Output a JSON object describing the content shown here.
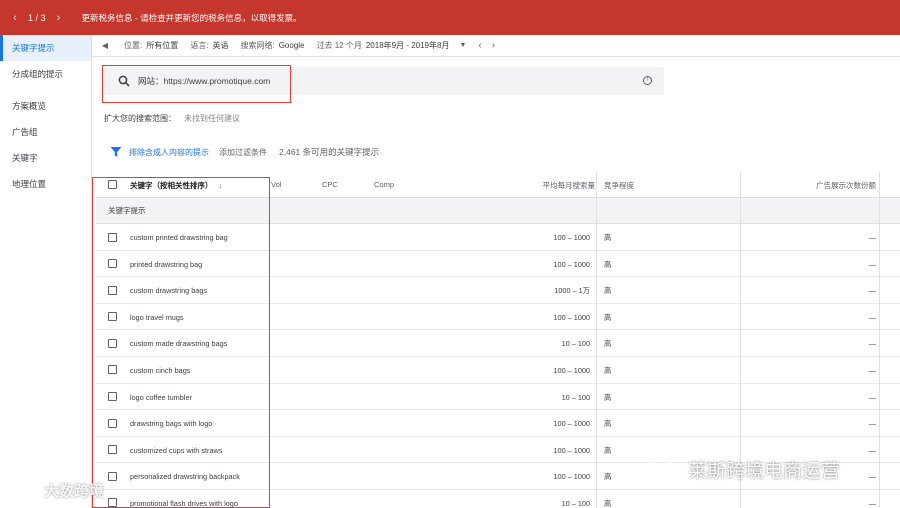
{
  "topbar": {
    "pager": "1 / 3",
    "message": "更新税务信息 - 请检查并更新您的税务信息，以取得发票。"
  },
  "sidebar": {
    "items": [
      {
        "label": "关键字提示",
        "active": true
      },
      {
        "label": "分成组的提示",
        "active": false
      },
      {
        "label": "方案概览",
        "active": false
      },
      {
        "label": "广告组",
        "active": false
      },
      {
        "label": "关键字",
        "active": false
      },
      {
        "label": "地理位置",
        "active": false
      }
    ]
  },
  "filters": {
    "location_label": "位置:",
    "location_value": "所有位置",
    "language_label": "语言:",
    "language_value": "英语",
    "network_label": "搜索网络:",
    "network_value": "Google",
    "period_label": "过去 12 个月",
    "period_value": "2018年9月 - 2019年8月"
  },
  "search": {
    "text": "网站：https://www.promotique.com"
  },
  "expand": {
    "label": "扩大您的搜索范围：",
    "value": "未找到任何建议"
  },
  "toolbar": {
    "exclude_adult": "排除含成人内容的提示",
    "add_filter": "添加过滤条件",
    "count": "2,461 条可用的关键字提示"
  },
  "table": {
    "headers": {
      "keyword": "关键字（按相关性排序）",
      "vol": "Vol",
      "cpc": "CPC",
      "comp": "Comp",
      "avg_searches": "平均每月搜索量",
      "competition": "竞争程度",
      "impression_share": "广告展示次数份额"
    },
    "group_label": "关键字提示",
    "rows": [
      {
        "keyword": "custom printed drawstring bag",
        "avg": "100 – 1000",
        "comp": "高",
        "imp": "—"
      },
      {
        "keyword": "printed drawstring bag",
        "avg": "100 – 1000",
        "comp": "高",
        "imp": "—"
      },
      {
        "keyword": "custom drawstring bags",
        "avg": "1000 – 1万",
        "comp": "高",
        "imp": "—"
      },
      {
        "keyword": "logo travel mugs",
        "avg": "100 – 1000",
        "comp": "高",
        "imp": "—"
      },
      {
        "keyword": "custom made drawstring bags",
        "avg": "10 – 100",
        "comp": "高",
        "imp": "—"
      },
      {
        "keyword": "custom cinch bags",
        "avg": "100 – 1000",
        "comp": "高",
        "imp": "—"
      },
      {
        "keyword": "logo coffee tumbler",
        "avg": "10 – 100",
        "comp": "高",
        "imp": "—"
      },
      {
        "keyword": "drawstring bags with logo",
        "avg": "100 – 1000",
        "comp": "高",
        "imp": "—"
      },
      {
        "keyword": "customized cups with straws",
        "avg": "100 – 1000",
        "comp": "高",
        "imp": "—"
      },
      {
        "keyword": "personalized drawstring backpack",
        "avg": "100 – 1000",
        "comp": "高",
        "imp": "—"
      },
      {
        "keyword": "promotional flash drives with logo",
        "avg": "10 – 100",
        "comp": "高",
        "imp": "—"
      }
    ]
  },
  "watermarks": {
    "left": "大数跨境",
    "right": "莱斯跨境电商运营"
  },
  "colors": {
    "header_red": "#c5372c",
    "highlight_red": "#e53935",
    "accent_blue": "#1a73e8"
  }
}
